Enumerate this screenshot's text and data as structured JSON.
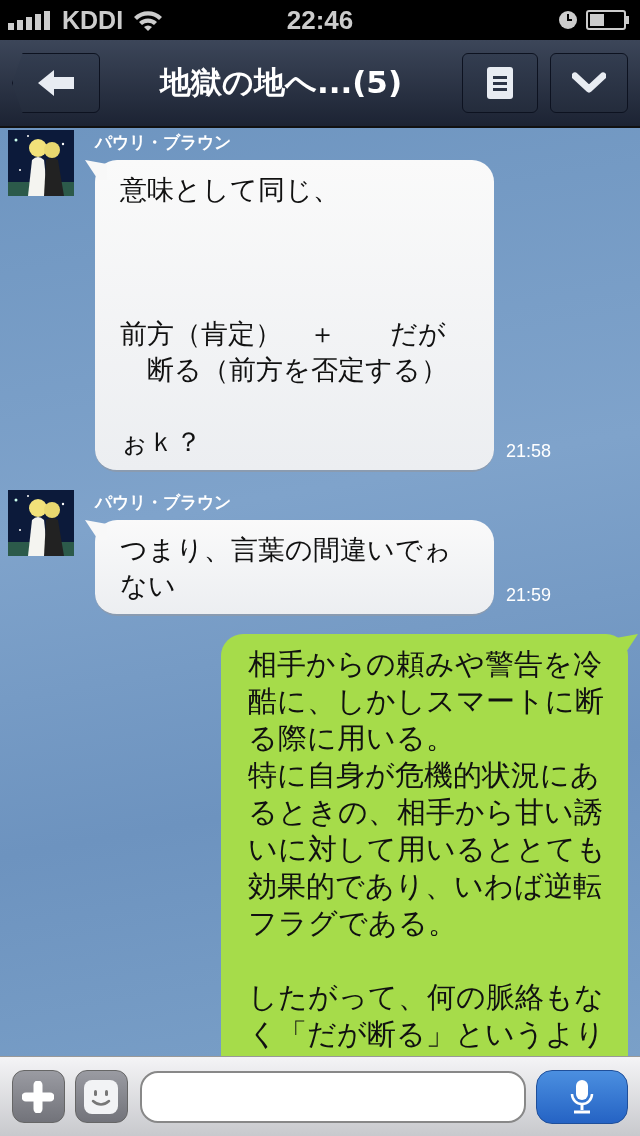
{
  "status_bar": {
    "carrier": "KDDI",
    "time": "22:46"
  },
  "header": {
    "title": "地獄の地へ...(5)"
  },
  "messages": [
    {
      "kind": "incoming",
      "sender": "パウリ・ブラウン",
      "time": "21:58",
      "paragraphs": [
        {
          "kind": "text",
          "text": "意味として同じ、"
        },
        {
          "kind": "blank"
        },
        {
          "kind": "blank"
        },
        {
          "kind": "blank"
        },
        {
          "kind": "text",
          "text": "前方（肯定）　＋　　だが"
        },
        {
          "kind": "text",
          "text": "　断る（前方を否定する）"
        },
        {
          "kind": "blank"
        },
        {
          "kind": "text",
          "text": "ぉｋ？"
        }
      ]
    },
    {
      "kind": "incoming",
      "sender": "パウリ・ブラウン",
      "time": "21:59",
      "paragraphs": [
        {
          "kind": "text",
          "text": "つまり、言葉の間違いでゎない"
        }
      ]
    },
    {
      "kind": "outgoing",
      "paragraphs": [
        {
          "kind": "text",
          "text": "相手からの頼みや警告を冷酷に、しかしスマートに断る際に用いる。"
        },
        {
          "kind": "text",
          "text": "特に自身が危機的状況にあるときの、相手から甘い誘いに対して用いるととても効果的であり、いわば逆転フラグである。"
        },
        {
          "kind": "blank"
        },
        {
          "kind": "text",
          "text": "したがって、何の脈絡もなく「だが断る」というより"
        }
      ]
    }
  ]
}
